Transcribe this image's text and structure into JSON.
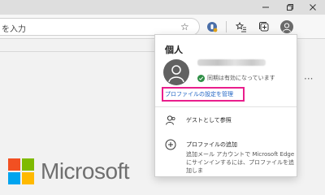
{
  "address_bar": {
    "placeholder_fragment": "を入力"
  },
  "popup": {
    "title": "個人",
    "sync_status": "同期は有効になっています",
    "manage_profile_link": "プロファイルの設定を管理",
    "guest_label": "ゲストとして参照",
    "add_profile_label": "プロファイルの追加",
    "add_profile_desc": "追加メール アカウントで Microsoft Edge にサインインするには、プロファイルを追加しま"
  },
  "page": {
    "brand": "Microsoft"
  },
  "colors": {
    "highlight": "#e91e8c",
    "link": "#2165c4",
    "sync_check": "#2f8f46",
    "ms_red": "#f25022",
    "ms_green": "#7fba00",
    "ms_blue": "#00a4ef",
    "ms_yellow": "#ffb900"
  },
  "icons": {
    "window": [
      "minimize-icon",
      "restore-icon",
      "close-icon"
    ],
    "toolbar": [
      "star-icon",
      "extension-icon",
      "favorites-icon",
      "collections-icon",
      "profile-icon"
    ],
    "menu": [
      "guest-icon",
      "add-profile-icon"
    ]
  }
}
